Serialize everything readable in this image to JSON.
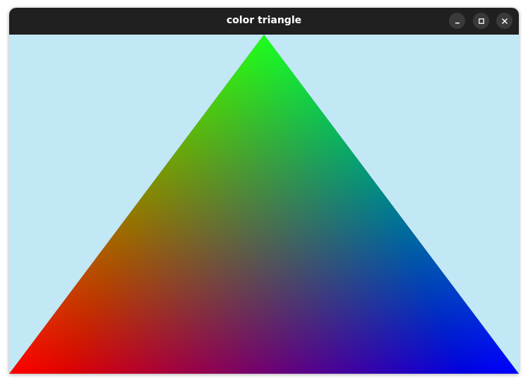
{
  "window": {
    "title": "color triangle"
  },
  "controls": {
    "minimize_icon": "minimize-icon",
    "maximize_icon": "maximize-icon",
    "close_icon": "close-icon"
  },
  "scene": {
    "background": "#c2e8f6",
    "vertex_colors": {
      "top": "#00ff00",
      "bottom_left": "#ff0000",
      "bottom_right": "#0000ff"
    }
  }
}
